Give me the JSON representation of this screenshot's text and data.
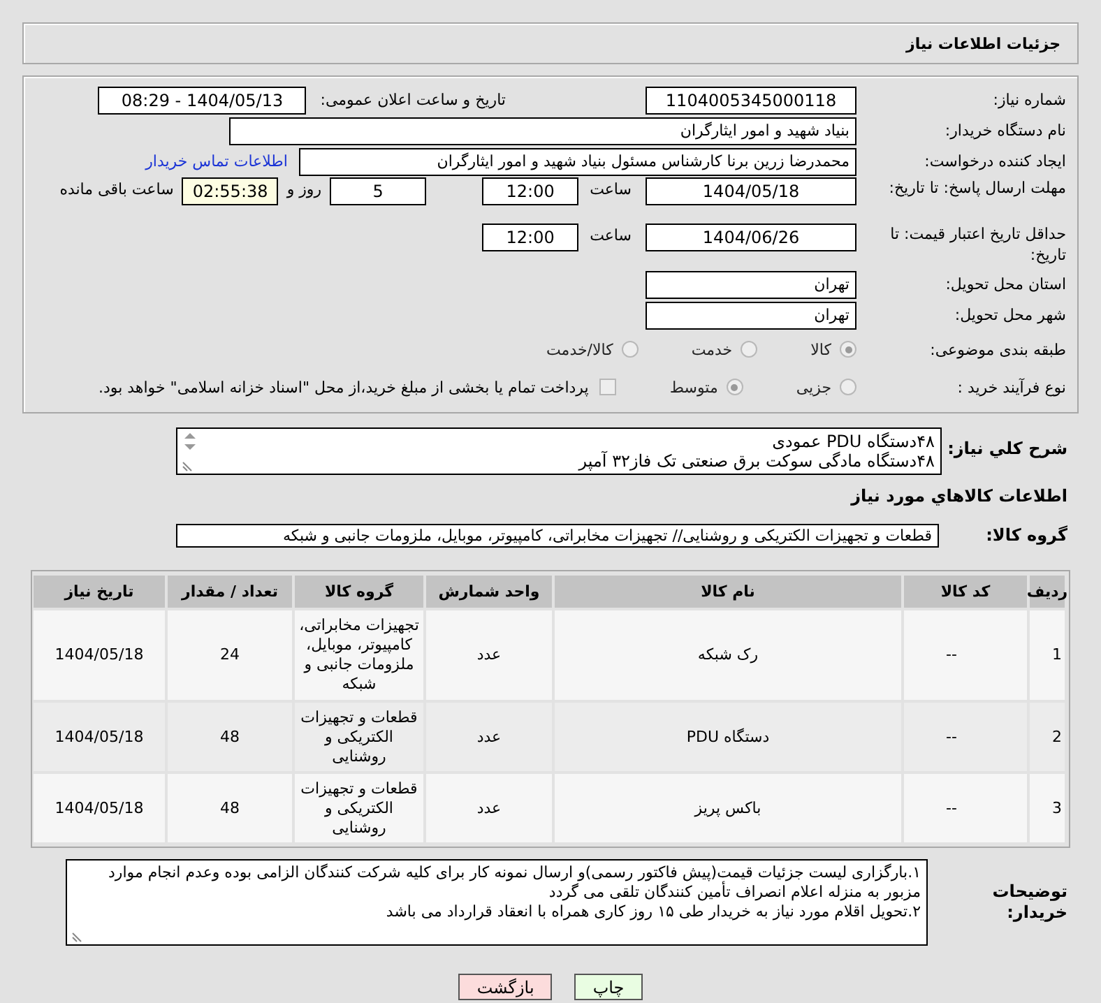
{
  "header": {
    "title": "جزئیات اطلاعات نیاز"
  },
  "need_number": {
    "label": "شماره نیاز:",
    "value": "1104005345000118"
  },
  "announce": {
    "label": "تاریخ و ساعت اعلان عمومی:",
    "value": "1404/05/13 - 08:29"
  },
  "buyer": {
    "label": "نام دستگاه خریدار:",
    "value": "بنیاد شهید و امور ایثارگران"
  },
  "creator": {
    "label": "ایجاد کننده درخواست:",
    "value": "محمدرضا زرین برنا کارشناس مسئول  بنیاد شهید و امور ایثارگران",
    "link": "اطلاعات تماس خریدار"
  },
  "deadline": {
    "label": "مهلت ارسال پاسخ: تا تاریخ:",
    "date": "1404/05/18",
    "time_label": "ساعت",
    "time": "12:00",
    "days": "5",
    "days_label": "روز و",
    "remaining": "02:55:38",
    "remaining_label": "ساعت باقی مانده"
  },
  "validity": {
    "label": "حداقل تاریخ اعتبار قیمت: تا تاریخ:",
    "date": "1404/06/26",
    "time_label": "ساعت",
    "time": "12:00"
  },
  "province": {
    "label": "استان محل تحویل:",
    "value": "تهران"
  },
  "city": {
    "label": "شهر محل تحویل:",
    "value": "تهران"
  },
  "category": {
    "label": "طبقه بندی موضوعی:",
    "options": [
      {
        "label": "کالا",
        "selected": true
      },
      {
        "label": "خدمت",
        "selected": false
      },
      {
        "label": "کالا/خدمت",
        "selected": false
      }
    ]
  },
  "process": {
    "label": "نوع فرآیند خرید :",
    "options": [
      {
        "label": "جزیی",
        "selected": false
      },
      {
        "label": "متوسط",
        "selected": true
      }
    ],
    "treasury": {
      "label": "پرداخت تمام یا بخشی از مبلغ خرید،از محل \"اسناد خزانه اسلامی\" خواهد بود.",
      "checked": false
    }
  },
  "description": {
    "label": "شرح کلي نياز:",
    "lines": [
      "۴۸دستگاه PDU عمودی",
      "۴۸دستگاه مادگی سوکت برق صنعتی تک فاز۳۲ آمپر"
    ]
  },
  "goods_title": "اطلاعات کالاهاي مورد نياز",
  "goods_group": {
    "label": "گروه کالا:",
    "value": "قطعات و تجهیزات الکتریکی و روشنایی// تجهیزات مخابراتی، کامپیوتر، موبایل، ملزومات جانبی و شبکه"
  },
  "table": {
    "columns": [
      "ردیف",
      "کد کالا",
      "نام کالا",
      "واحد شمارش",
      "گروه کالا",
      "تعداد / مقدار",
      "تاریخ نیاز"
    ],
    "rows": [
      {
        "cells": [
          "1",
          "--",
          "رک شبکه",
          "عدد",
          "تجهیزات مخابراتی، کامپیوتر، موبایل، ملزومات جانبی و شبکه",
          "24",
          "1404/05/18"
        ]
      },
      {
        "cells": [
          "2",
          "--",
          "دستگاه PDU",
          "عدد",
          "قطعات و تجهیزات الکتریکی و روشنایی",
          "48",
          "1404/05/18"
        ]
      },
      {
        "cells": [
          "3",
          "--",
          "باکس پریز",
          "عدد",
          "قطعات و تجهیزات الکتریکی و روشنایی",
          "48",
          "1404/05/18"
        ]
      }
    ]
  },
  "notes": {
    "label": "توضیحات خریدار:",
    "lines": [
      "۱.بارگزاری لیست جزئیات قیمت(پیش فاکتور رسمی)و ارسال نمونه کار برای کلیه شرکت کنندگان الزامی بوده وعدم انجام موارد مزبور به منزله اعلام انصراف تأمین کنندگان تلقی می گردد",
      "۲.تحویل اقلام مورد نیاز به خریدار طی ۱۵ روز کاری همراه با انعقاد قرارداد می باشد"
    ]
  },
  "buttons": [
    {
      "label": "چاپ",
      "kind": "print"
    },
    {
      "label": "بازگشت",
      "kind": "back"
    }
  ]
}
